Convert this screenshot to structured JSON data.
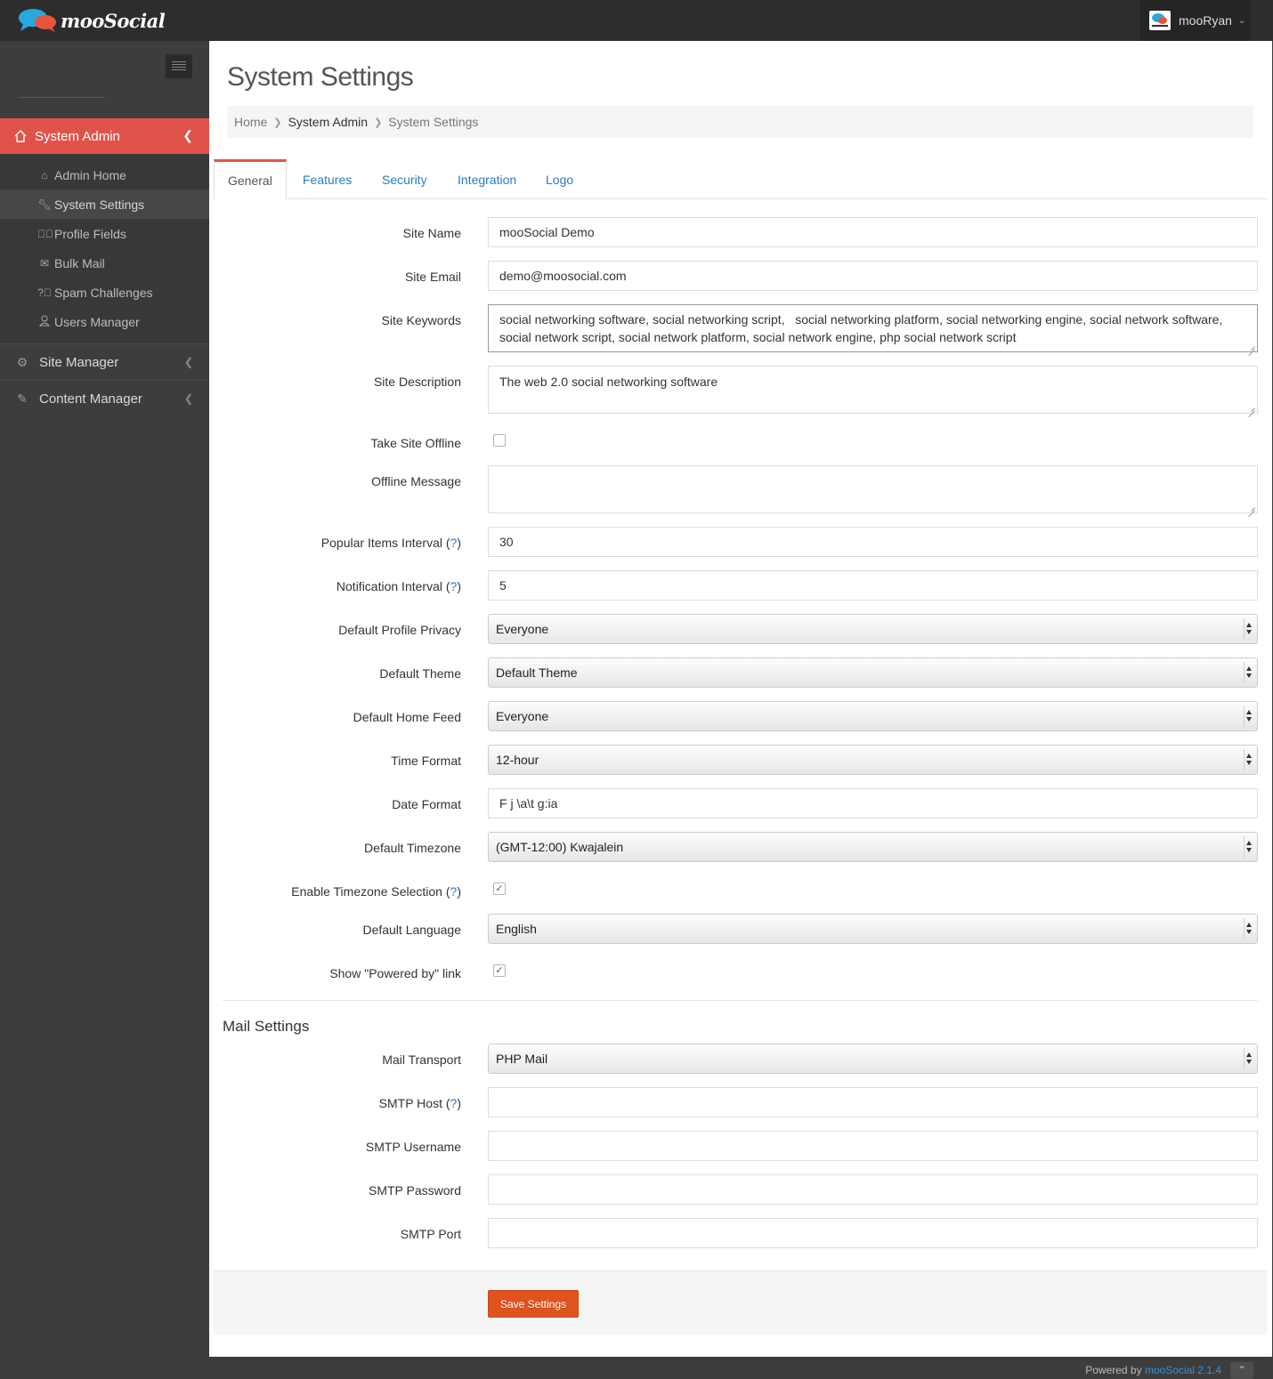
{
  "brand": {
    "name": "mooSocial"
  },
  "user": {
    "name": "mooRyan"
  },
  "sidebar": {
    "active": {
      "label": "System Admin"
    },
    "subitems": [
      {
        "label": "Admin Home",
        "icon": "home-icon"
      },
      {
        "label": "System Settings",
        "icon": "wrench-icon"
      },
      {
        "label": "Profile Fields",
        "icon": "check-circle-icon"
      },
      {
        "label": "Bulk Mail",
        "icon": "envelope-icon"
      },
      {
        "label": "Spam Challenges",
        "icon": "question-circle-icon"
      },
      {
        "label": "Users Manager",
        "icon": "user-icon"
      }
    ],
    "items": [
      {
        "label": "Site Manager",
        "icon": "gears-icon"
      },
      {
        "label": "Content Manager",
        "icon": "pencil-icon"
      }
    ]
  },
  "page": {
    "title": "System Settings"
  },
  "breadcrumb": [
    "Home",
    "System Admin",
    "System Settings"
  ],
  "tabs": [
    "General",
    "Features",
    "Security",
    "Integration",
    "Logo"
  ],
  "form": {
    "site_name": {
      "label": "Site Name",
      "value": "mooSocial Demo"
    },
    "site_email": {
      "label": "Site Email",
      "value": "demo@moosocial.com"
    },
    "site_keywords": {
      "label": "Site Keywords",
      "line1": "social networking software, social networking script,   social networking platform, social networking engine, social network software,",
      "line2": "social network script, social network platform, social network engine, php social network script"
    },
    "site_description": {
      "label": "Site Description",
      "value": "The web 2.0 social networking software"
    },
    "take_offline": {
      "label": "Take Site Offline",
      "checked": false
    },
    "offline_message": {
      "label": "Offline Message",
      "value": ""
    },
    "popular_interval": {
      "label": "Popular Items Interval",
      "value": "30"
    },
    "notification_interval": {
      "label": "Notification Interval",
      "value": "5"
    },
    "profile_privacy": {
      "label": "Default Profile Privacy",
      "value": "Everyone"
    },
    "theme": {
      "label": "Default Theme",
      "value": "Default Theme"
    },
    "home_feed": {
      "label": "Default Home Feed",
      "value": "Everyone"
    },
    "time_format": {
      "label": "Time Format",
      "value": "12-hour"
    },
    "date_format": {
      "label": "Date Format",
      "value": "F j \\a\\t g:ia"
    },
    "timezone": {
      "label": "Default Timezone",
      "value": "(GMT-12:00) Kwajalein"
    },
    "timezone_selection": {
      "label": "Enable Timezone Selection",
      "checked": true
    },
    "language": {
      "label": "Default Language",
      "value": "English"
    },
    "powered_by": {
      "label": "Show \"Powered by\" link",
      "checked": true
    }
  },
  "help_mark": "?",
  "mail": {
    "title": "Mail Settings",
    "transport": {
      "label": "Mail Transport",
      "value": "PHP Mail"
    },
    "smtp_host": {
      "label": "SMTP Host",
      "value": ""
    },
    "smtp_username": {
      "label": "SMTP Username",
      "value": ""
    },
    "smtp_password": {
      "label": "SMTP Password",
      "value": ""
    },
    "smtp_port": {
      "label": "SMTP Port",
      "value": ""
    }
  },
  "save_label": "Save Settings",
  "footer": {
    "prefix": "Powered by",
    "link": "mooSocial 2.1.4"
  },
  "colors": {
    "accent": "#e0534a",
    "save": "#e0531f",
    "link": "#2a7ac8"
  }
}
